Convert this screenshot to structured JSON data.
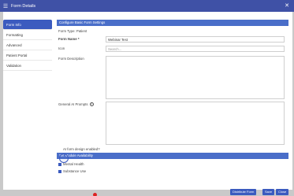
{
  "window": {
    "title": "Form Details"
  },
  "sidebar": {
    "items": [
      {
        "label": "Form Info",
        "active": true
      },
      {
        "label": "Formatting"
      },
      {
        "label": "Advanced"
      },
      {
        "label": "Patient Portal"
      },
      {
        "label": "Validation"
      }
    ]
  },
  "main": {
    "section_title": "Configure Basic Form Settings",
    "form_type": "Form Type: Patient",
    "form_name": {
      "label": "Form Name *",
      "value": "Webinar Test"
    },
    "icon": {
      "label": "Icon",
      "placeholder": "Search..."
    },
    "form_description": {
      "label": "Form Description"
    },
    "ai_prompts": {
      "label": "General AI Prompts"
    },
    "ai_design": {
      "label": "AI form design enabled?"
    },
    "module_section_title": "Set Module Availability",
    "modules": [
      "Mental Health",
      "Substance Use"
    ]
  },
  "footer": {
    "distribute": "Distribute Form",
    "save": "Save",
    "close": "Close"
  },
  "colors": {
    "header": "#3f51a6",
    "accent": "#3b5bbf",
    "section": "#4a6ec9"
  }
}
